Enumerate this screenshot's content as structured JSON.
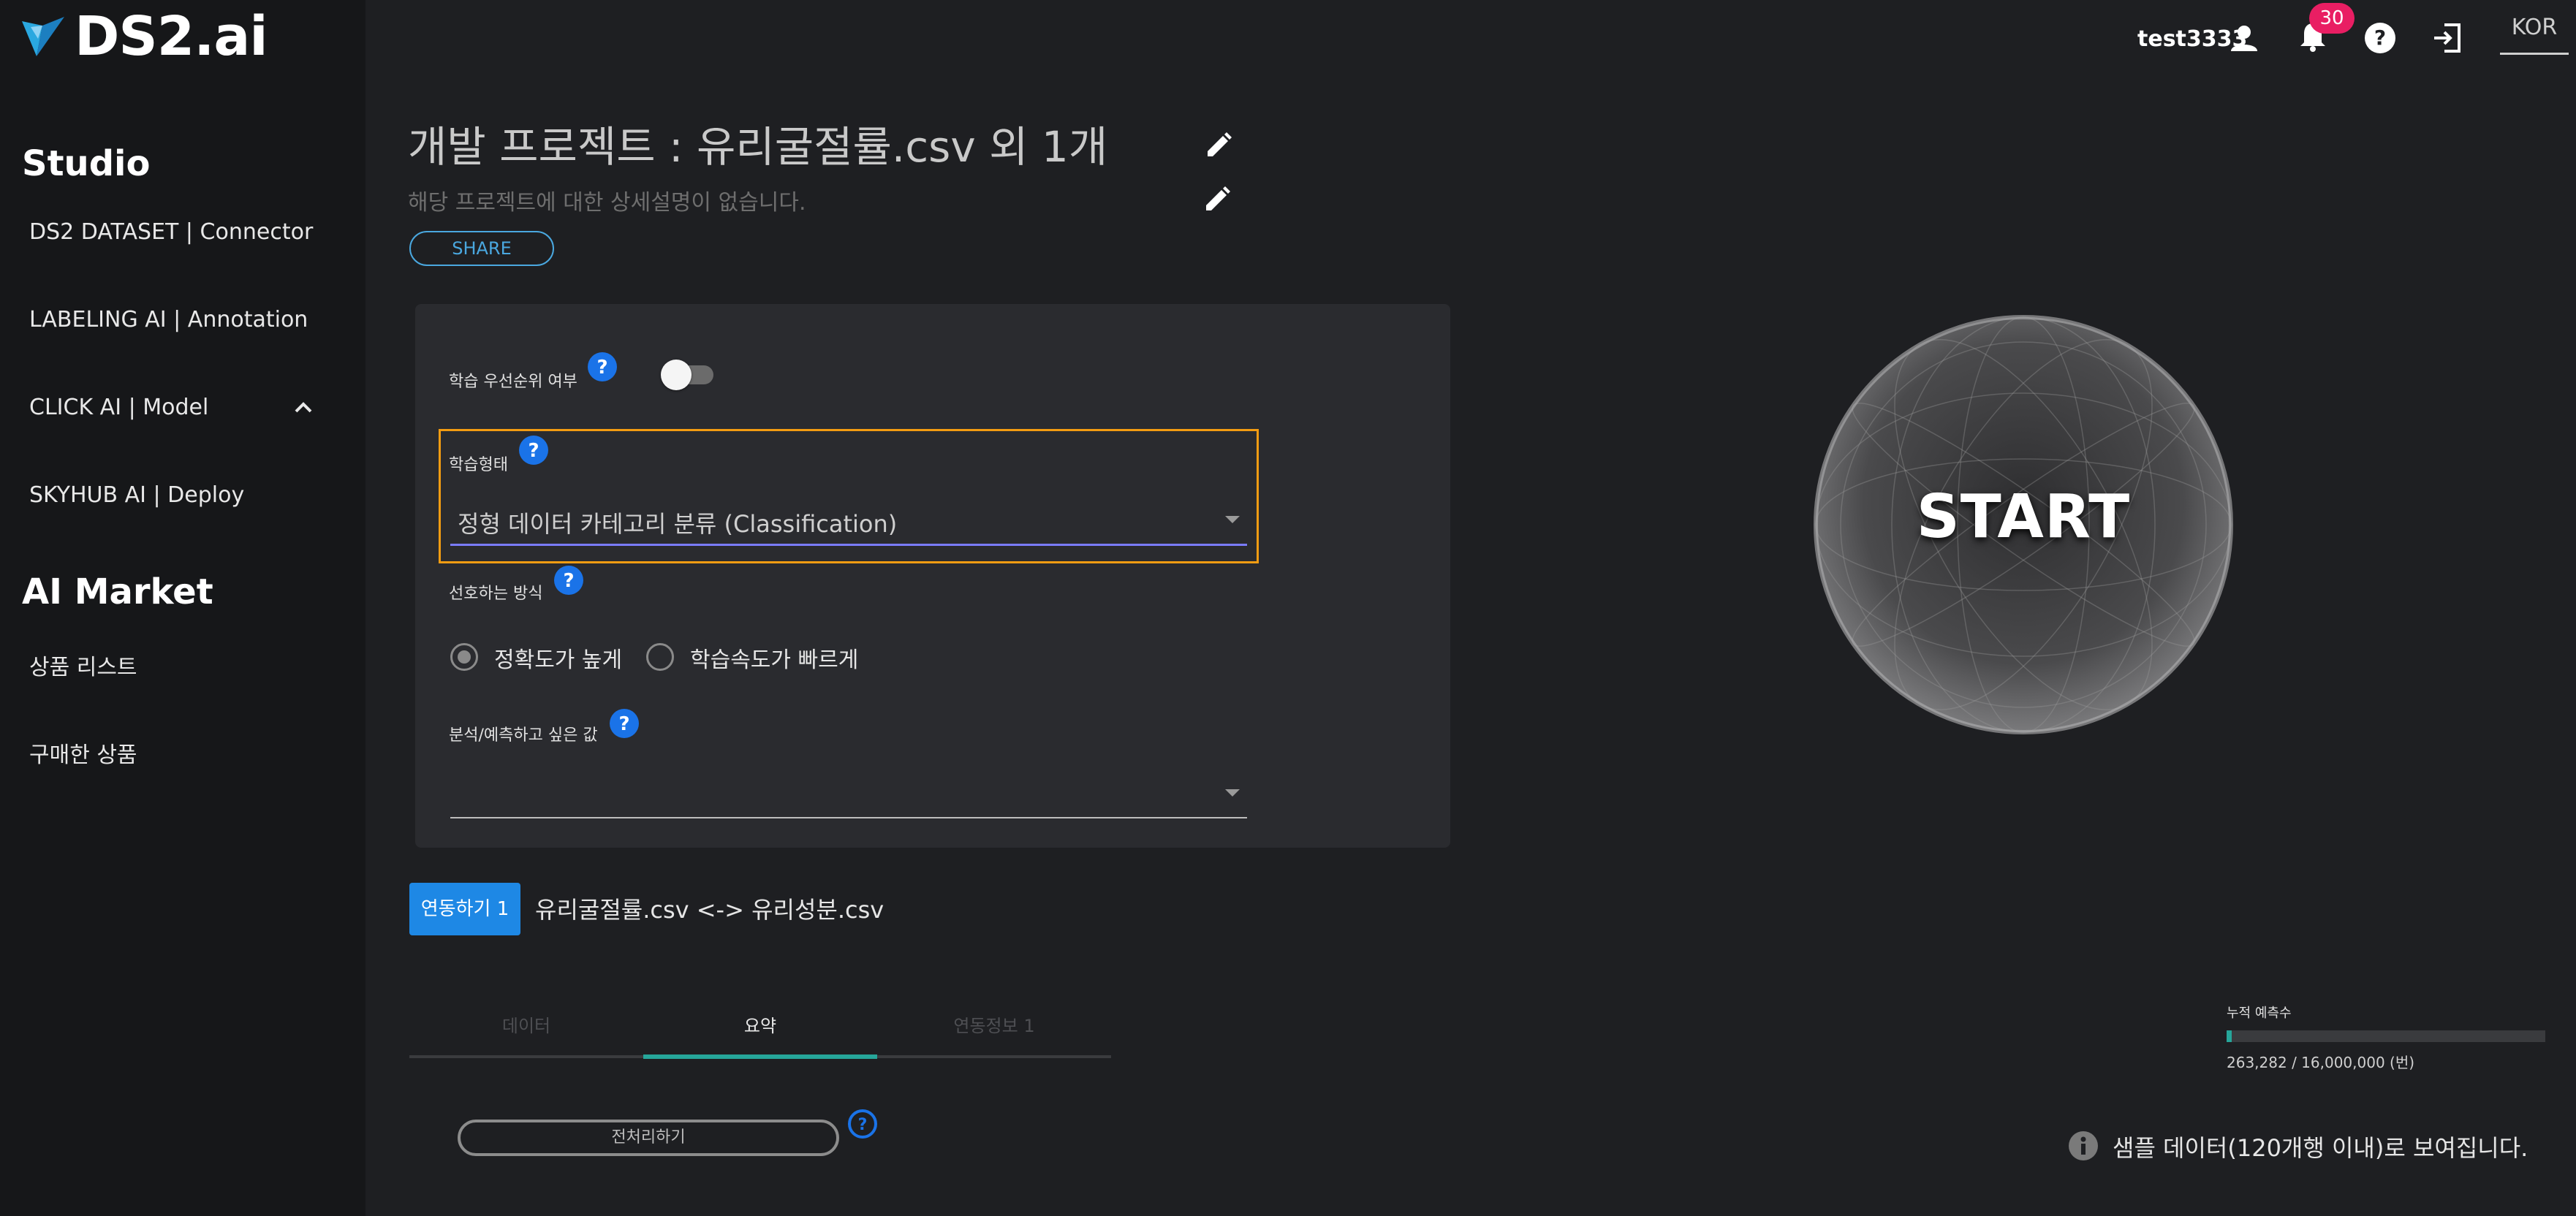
{
  "brand": {
    "name": "DS2.ai"
  },
  "header": {
    "username": "test3333",
    "notification_count": "30",
    "language": "KOR"
  },
  "sidebar": {
    "studio_title": "Studio",
    "studio_items": [
      {
        "label": "DS2 DATASET | Connector"
      },
      {
        "label": "LABELING AI | Annotation"
      },
      {
        "label": "CLICK AI | Model"
      },
      {
        "label": "SKYHUB AI | Deploy"
      }
    ],
    "market_title": "AI Market",
    "market_items": [
      {
        "label": "상품 리스트"
      },
      {
        "label": "구매한 상품"
      }
    ]
  },
  "project": {
    "title": "개발 프로젝트 : 유리굴절률.csv 외 1개",
    "description": "해당 프로젝트에 대한 상세설명이 없습니다.",
    "share_label": "SHARE"
  },
  "settings": {
    "priority_label": "학습 우선순위 여부",
    "priority_enabled": false,
    "learning_type_label": "학습형태",
    "learning_type_value": "정형 데이터 카테고리 분류 (Classification)",
    "preference_label": "선호하는 방식",
    "preference_options": [
      {
        "label": "정확도가 높게",
        "selected": true
      },
      {
        "label": "학습속도가 빠르게",
        "selected": false
      }
    ],
    "target_label": "분석/예측하고 싶은 값",
    "target_value": ""
  },
  "link": {
    "button_label": "연동하기 1",
    "description": "유리굴절률.csv <-> 유리성분.csv"
  },
  "tabs": [
    {
      "label": "데이터",
      "active": false
    },
    {
      "label": "요약",
      "active": true
    },
    {
      "label": "연동정보 1",
      "active": false
    }
  ],
  "preprocess_label": "전처리하기",
  "start_label": "START",
  "prediction": {
    "label": "누적 예측수",
    "count_text": "263,282 / 16,000,000 (번)",
    "used": 263282,
    "total": 16000000
  },
  "sample_note": "샘플 데이터(120개행 이내)로 보여집니다.",
  "colors": {
    "accent_blue": "#1e88e5",
    "teal": "#26a69a",
    "highlight_orange": "#f39c12",
    "badge_pink": "#e91e63"
  },
  "icons": {
    "user": "user-icon",
    "bell": "bell-icon",
    "help": "help-icon",
    "logout": "logout-icon",
    "edit": "pencil-icon",
    "info": "info-icon"
  }
}
